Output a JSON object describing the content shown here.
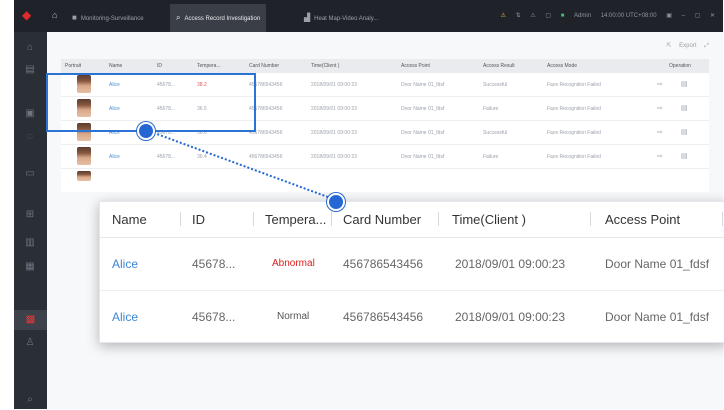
{
  "topbar": {
    "tabs": [
      {
        "label": "Monitoring-Surveillance",
        "icon": "monitor-icon",
        "active": false
      },
      {
        "label": "Access Record Investigation",
        "icon": "search-icon",
        "active": true
      },
      {
        "label": "Heat Map-Video Analy...",
        "icon": "chart-icon",
        "active": false
      }
    ],
    "user": "Admin",
    "clock": "14:00:00 UTC+08:00"
  },
  "toolbar": {
    "export_label": "Export"
  },
  "bg_table": {
    "headers": [
      "Portrait",
      "Name",
      "ID",
      "Tempera...",
      "Card Number",
      "Time(Client )",
      "Access Point",
      "Access Result",
      "Access Mode",
      "Operation"
    ],
    "rows": [
      {
        "name": "Alice",
        "id": "45678...",
        "temp": "38.2",
        "card": "456786543456",
        "time": "2018/09/01 09:00:23",
        "point": "Door Name 01_fdsf",
        "result": "Successful",
        "mode": "Face Recognition Failed"
      },
      {
        "name": "Alice",
        "id": "45678...",
        "temp": "36.5",
        "card": "456786543456",
        "time": "2018/09/01 09:00:23",
        "point": "Door Name 01_fdsf",
        "result": "Failure",
        "mode": "Face Recognition Failed"
      },
      {
        "name": "Alice",
        "id": "45678...",
        "temp": "36.6",
        "card": "456786543456",
        "time": "2018/09/01 09:00:23",
        "point": "Door Name 01_fdsf",
        "result": "Successful",
        "mode": "Face Recognition Failed"
      },
      {
        "name": "Alice",
        "id": "45678...",
        "temp": "36.4",
        "card": "456786543456",
        "time": "2018/09/01 09:00:23",
        "point": "Door Name 01_fdsf",
        "result": "Failure",
        "mode": "Face Recognition Failed"
      }
    ]
  },
  "zoom": {
    "headers": [
      "Name",
      "ID",
      "Tempera...",
      "Card Number",
      "Time(Client )",
      "Access Point"
    ],
    "rows": [
      {
        "name": "Alice",
        "id": "45678...",
        "temp": "Abnormal",
        "card": "456786543456",
        "time": "2018/09/01 09:00:23",
        "point": "Door Name 01_fdsf"
      },
      {
        "name": "Alice",
        "id": "45678...",
        "temp": "Normal",
        "card": "456786543456",
        "time": "2018/09/01 09:00:23",
        "point": "Door Name 01_fdsf"
      }
    ]
  },
  "colors": {
    "accent": "#2467d4",
    "abnormal": "#e01d1d",
    "link": "#3b86d6"
  }
}
